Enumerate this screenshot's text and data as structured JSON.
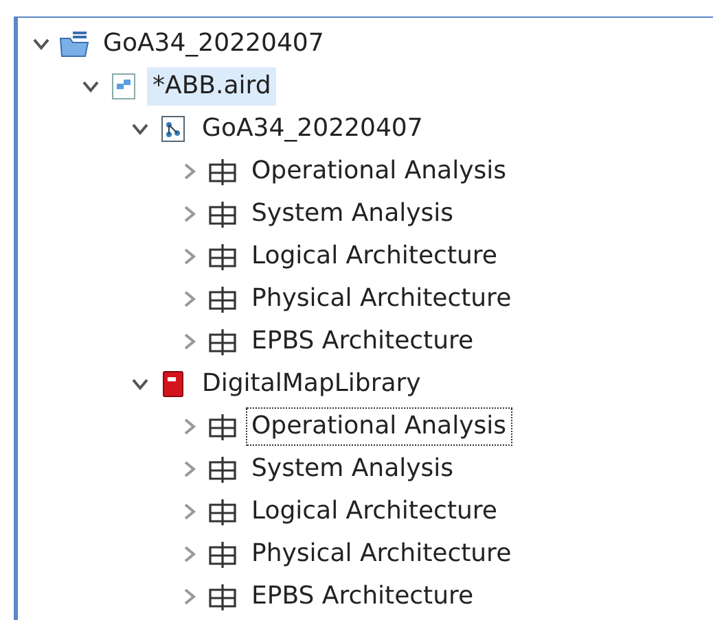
{
  "tree": [
    {
      "label": "GoA34_20220407",
      "kind": "project",
      "expanded": true,
      "selected": false,
      "focused": false,
      "children": [
        {
          "label": "*ABB.aird",
          "kind": "session",
          "expanded": true,
          "selected": true,
          "focused": false,
          "children": [
            {
              "label": "GoA34_20220407",
              "kind": "model",
              "expanded": true,
              "selected": false,
              "focused": false,
              "children": [
                {
                  "label": "Operational Analysis",
                  "kind": "layer",
                  "expanded": false,
                  "selected": false,
                  "focused": false
                },
                {
                  "label": "System Analysis",
                  "kind": "layer",
                  "expanded": false,
                  "selected": false,
                  "focused": false
                },
                {
                  "label": "Logical Architecture",
                  "kind": "layer",
                  "expanded": false,
                  "selected": false,
                  "focused": false
                },
                {
                  "label": "Physical Architecture",
                  "kind": "layer",
                  "expanded": false,
                  "selected": false,
                  "focused": false
                },
                {
                  "label": "EPBS Architecture",
                  "kind": "layer",
                  "expanded": false,
                  "selected": false,
                  "focused": false
                }
              ]
            },
            {
              "label": "DigitalMapLibrary",
              "kind": "library",
              "expanded": true,
              "selected": false,
              "focused": false,
              "children": [
                {
                  "label": "Operational Analysis",
                  "kind": "layer",
                  "expanded": false,
                  "selected": false,
                  "focused": true
                },
                {
                  "label": "System Analysis",
                  "kind": "layer",
                  "expanded": false,
                  "selected": false,
                  "focused": false
                },
                {
                  "label": "Logical Architecture",
                  "kind": "layer",
                  "expanded": false,
                  "selected": false,
                  "focused": false
                },
                {
                  "label": "Physical Architecture",
                  "kind": "layer",
                  "expanded": false,
                  "selected": false,
                  "focused": false
                },
                {
                  "label": "EPBS Architecture",
                  "kind": "layer",
                  "expanded": false,
                  "selected": false,
                  "focused": false
                }
              ]
            }
          ]
        }
      ]
    }
  ]
}
